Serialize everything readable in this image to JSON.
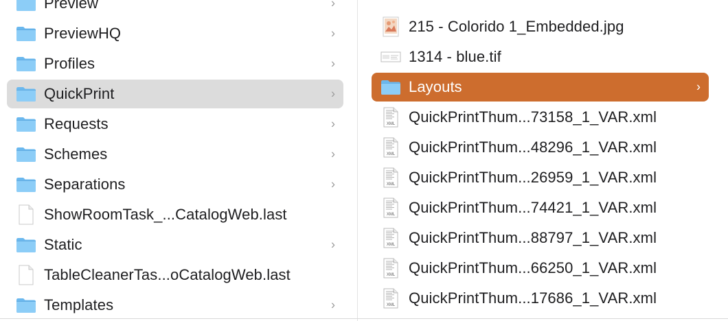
{
  "colors": {
    "folder_back": "#6bb8ee",
    "folder_front": "#8ccdf7",
    "selection_gray": "#dcdcdc",
    "selection_accent": "#cd6d2e"
  },
  "left_column": {
    "items": [
      {
        "label": "Preview",
        "type": "folder",
        "chevron": "›"
      },
      {
        "label": "PreviewHQ",
        "type": "folder",
        "chevron": "›"
      },
      {
        "label": "Profiles",
        "type": "folder",
        "chevron": "›"
      },
      {
        "label": "QuickPrint",
        "type": "folder",
        "chevron": "›",
        "selected": true
      },
      {
        "label": "Requests",
        "type": "folder",
        "chevron": "›"
      },
      {
        "label": "Schemes",
        "type": "folder",
        "chevron": "›"
      },
      {
        "label": "Separations",
        "type": "folder",
        "chevron": "›"
      },
      {
        "label": "ShowRoomTask_...CatalogWeb.last",
        "type": "document"
      },
      {
        "label": "Static",
        "type": "folder",
        "chevron": "›"
      },
      {
        "label": "TableCleanerTas...oCatalogWeb.last",
        "type": "document"
      },
      {
        "label": "Templates",
        "type": "folder",
        "chevron": "›"
      }
    ]
  },
  "right_column": {
    "items": [
      {
        "label": "215 - Colorido 1_Embedded.jpg",
        "type": "image-jpg"
      },
      {
        "label": "1314 - blue.tif",
        "type": "image-tif"
      },
      {
        "label": "Layouts",
        "type": "folder",
        "chevron": "›",
        "selected": true
      },
      {
        "label": "QuickPrintThum...73158_1_VAR.xml",
        "type": "xml",
        "badge": "XML"
      },
      {
        "label": "QuickPrintThum...48296_1_VAR.xml",
        "type": "xml",
        "badge": "XML"
      },
      {
        "label": "QuickPrintThum...26959_1_VAR.xml",
        "type": "xml",
        "badge": "XML"
      },
      {
        "label": "QuickPrintThum...74421_1_VAR.xml",
        "type": "xml",
        "badge": "XML"
      },
      {
        "label": "QuickPrintThum...88797_1_VAR.xml",
        "type": "xml",
        "badge": "XML"
      },
      {
        "label": "QuickPrintThum...66250_1_VAR.xml",
        "type": "xml",
        "badge": "XML"
      },
      {
        "label": "QuickPrintThum...17686_1_VAR.xml",
        "type": "xml",
        "badge": "XML"
      }
    ]
  }
}
